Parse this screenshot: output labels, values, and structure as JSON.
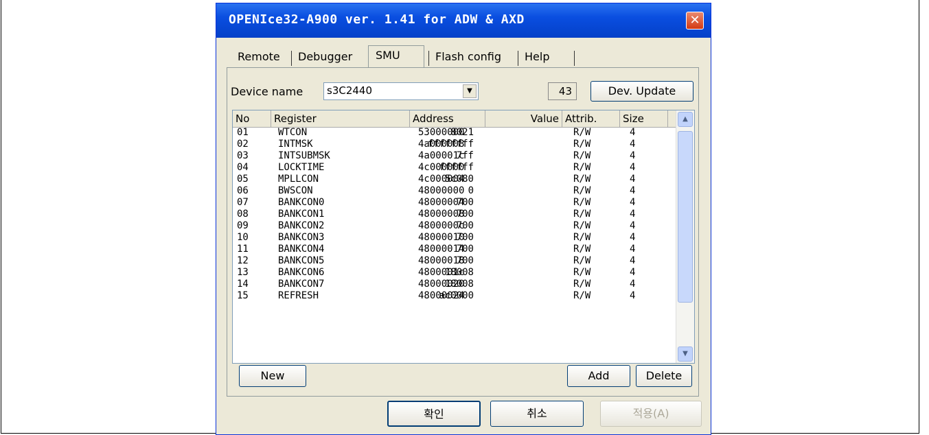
{
  "window": {
    "title": "OPENIce32-A900  ver. 1.41 for ADW & AXD",
    "close_symbol": "✕"
  },
  "tabs": [
    {
      "label": "Remote"
    },
    {
      "label": "Debugger"
    },
    {
      "label": "SMU"
    },
    {
      "label": "Flash config"
    },
    {
      "label": "Help"
    }
  ],
  "device": {
    "label": "Device name",
    "value": "s3C2440",
    "count": "43",
    "update_label": "Dev. Update"
  },
  "table": {
    "headers": {
      "no": "No",
      "register": "Register",
      "address": "Address",
      "value": "Value",
      "attrib": "Attrib.",
      "size": "Size"
    },
    "rows": [
      {
        "no": "01",
        "register": "WTCON",
        "address": "53000000",
        "value": "8021",
        "attrib": "R/W",
        "size": "4"
      },
      {
        "no": "02",
        "register": "INTMSK",
        "address": "4a000008",
        "value": "ffffffff",
        "attrib": "R/W",
        "size": "4"
      },
      {
        "no": "03",
        "register": "INTSUBMSK",
        "address": "4a00001c",
        "value": "7ff",
        "attrib": "R/W",
        "size": "4"
      },
      {
        "no": "04",
        "register": "LOCKTIME",
        "address": "4c000000",
        "value": "ffffff",
        "attrib": "R/W",
        "size": "4"
      },
      {
        "no": "05",
        "register": "MPLLCON",
        "address": "4c000004",
        "value": "5c080",
        "attrib": "R/W",
        "size": "4"
      },
      {
        "no": "06",
        "register": "BWSCON",
        "address": "48000000",
        "value": "0",
        "attrib": "R/W",
        "size": "4"
      },
      {
        "no": "07",
        "register": "BANKCON0",
        "address": "48000004",
        "value": "700",
        "attrib": "R/W",
        "size": "4"
      },
      {
        "no": "08",
        "register": "BANKCON1",
        "address": "48000008",
        "value": "700",
        "attrib": "R/W",
        "size": "4"
      },
      {
        "no": "09",
        "register": "BANKCON2",
        "address": "4800000c",
        "value": "700",
        "attrib": "R/W",
        "size": "4"
      },
      {
        "no": "10",
        "register": "BANKCON3",
        "address": "48000010",
        "value": "700",
        "attrib": "R/W",
        "size": "4"
      },
      {
        "no": "11",
        "register": "BANKCON4",
        "address": "48000014",
        "value": "700",
        "attrib": "R/W",
        "size": "4"
      },
      {
        "no": "12",
        "register": "BANKCON5",
        "address": "48000018",
        "value": "700",
        "attrib": "R/W",
        "size": "4"
      },
      {
        "no": "13",
        "register": "BANKCON6",
        "address": "4800001c",
        "value": "18008",
        "attrib": "R/W",
        "size": "4"
      },
      {
        "no": "14",
        "register": "BANKCON7",
        "address": "48000020",
        "value": "18008",
        "attrib": "R/W",
        "size": "4"
      },
      {
        "no": "15",
        "register": "REFRESH",
        "address": "48000024",
        "value": "ac0000",
        "attrib": "R/W",
        "size": "4"
      }
    ]
  },
  "actions": {
    "new": "New",
    "add": "Add",
    "delete": "Delete"
  },
  "footer": {
    "ok": "확인",
    "cancel": "취소",
    "apply": "적용(A)"
  },
  "icons": {
    "combo_arrow": "▼",
    "scroll_up": "▲",
    "scroll_down": "▼"
  }
}
